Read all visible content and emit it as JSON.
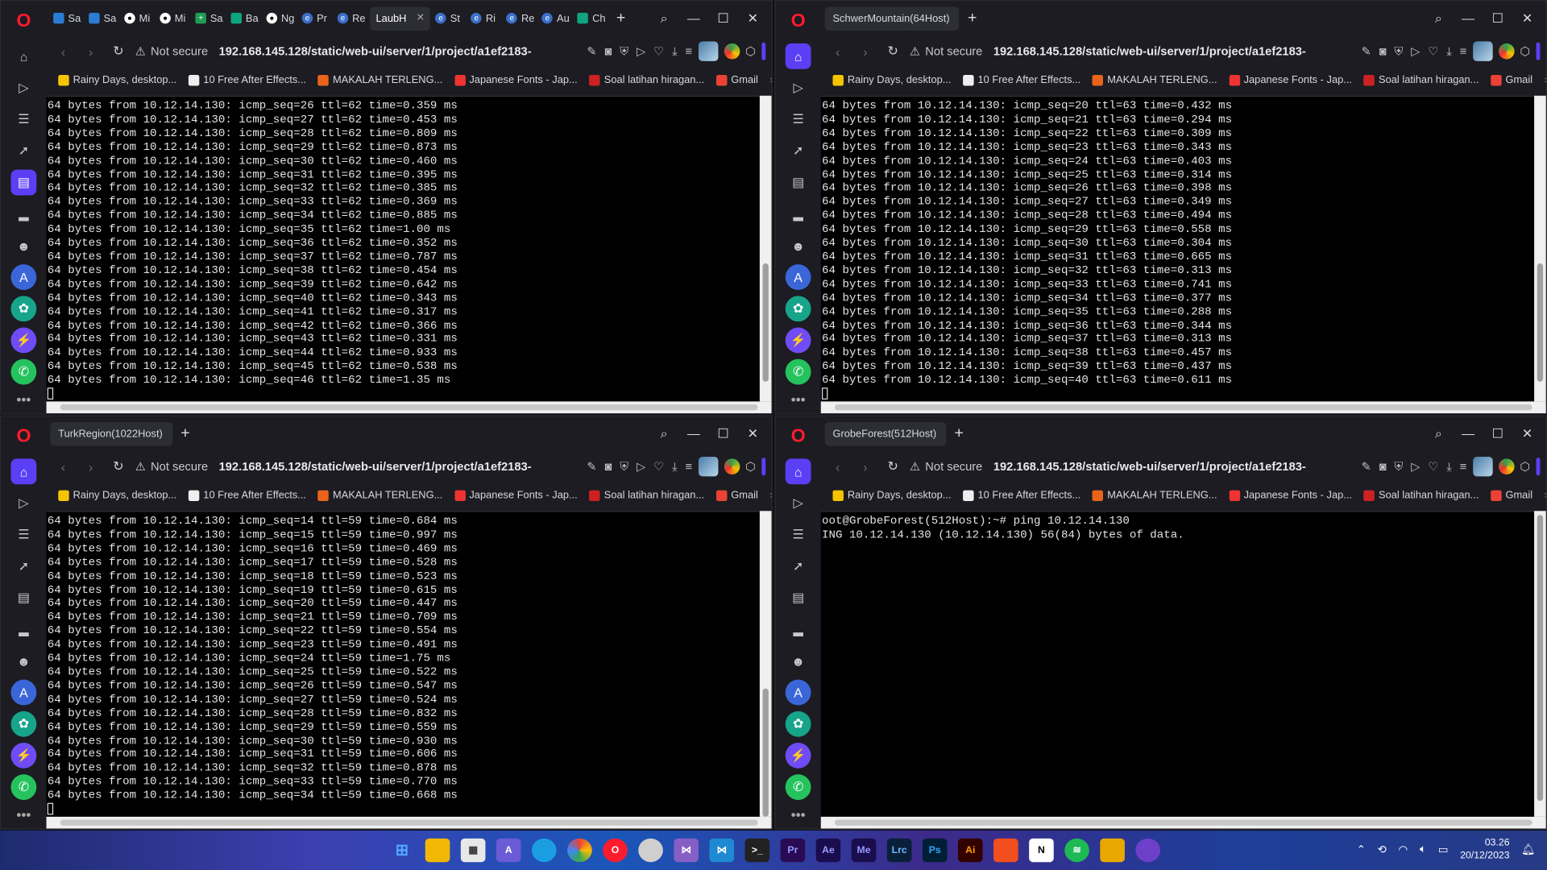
{
  "windows": {
    "tl": {
      "tabs": [
        "Sa",
        "Sa",
        "Mi",
        "Mi",
        "Sa",
        "Ba",
        "Ng",
        "Pr",
        "Re",
        "LaubH",
        "St",
        "Ri",
        "Re",
        "Au",
        "Ch"
      ],
      "active_tab": "LaubH"
    },
    "tr": {
      "tab_title": "SchwerMountain(64Host)"
    },
    "bl": {
      "tab_title": "TurkRegion(1022Host)"
    },
    "br": {
      "tab_title": "GrobeForest(512Host)"
    }
  },
  "browser": {
    "not_secure": "Not secure",
    "url": "192.168.145.128/static/web-ui/server/1/project/a1ef2183-",
    "bookmarks": [
      "Rainy Days, desktop...",
      "10 Free After Effects...",
      "MAKALAH TERLENG...",
      "Japanese Fonts - Jap...",
      "Soal latihan hiragan...",
      "Gmail"
    ],
    "bookmark_more": "»"
  },
  "terminals": {
    "tl": [
      "64 bytes from 10.12.14.130: icmp_seq=26 ttl=62 time=0.359 ms",
      "64 bytes from 10.12.14.130: icmp_seq=27 ttl=62 time=0.453 ms",
      "64 bytes from 10.12.14.130: icmp_seq=28 ttl=62 time=0.809 ms",
      "64 bytes from 10.12.14.130: icmp_seq=29 ttl=62 time=0.873 ms",
      "64 bytes from 10.12.14.130: icmp_seq=30 ttl=62 time=0.460 ms",
      "64 bytes from 10.12.14.130: icmp_seq=31 ttl=62 time=0.395 ms",
      "64 bytes from 10.12.14.130: icmp_seq=32 ttl=62 time=0.385 ms",
      "64 bytes from 10.12.14.130: icmp_seq=33 ttl=62 time=0.369 ms",
      "64 bytes from 10.12.14.130: icmp_seq=34 ttl=62 time=0.885 ms",
      "64 bytes from 10.12.14.130: icmp_seq=35 ttl=62 time=1.00 ms",
      "64 bytes from 10.12.14.130: icmp_seq=36 ttl=62 time=0.352 ms",
      "64 bytes from 10.12.14.130: icmp_seq=37 ttl=62 time=0.787 ms",
      "64 bytes from 10.12.14.130: icmp_seq=38 ttl=62 time=0.454 ms",
      "64 bytes from 10.12.14.130: icmp_seq=39 ttl=62 time=0.642 ms",
      "64 bytes from 10.12.14.130: icmp_seq=40 ttl=62 time=0.343 ms",
      "64 bytes from 10.12.14.130: icmp_seq=41 ttl=62 time=0.317 ms",
      "64 bytes from 10.12.14.130: icmp_seq=42 ttl=62 time=0.366 ms",
      "64 bytes from 10.12.14.130: icmp_seq=43 ttl=62 time=0.331 ms",
      "64 bytes from 10.12.14.130: icmp_seq=44 ttl=62 time=0.933 ms",
      "64 bytes from 10.12.14.130: icmp_seq=45 ttl=62 time=0.538 ms",
      "64 bytes from 10.12.14.130: icmp_seq=46 ttl=62 time=1.35 ms"
    ],
    "tr": [
      "64 bytes from 10.12.14.130: icmp_seq=20 ttl=63 time=0.432 ms",
      "64 bytes from 10.12.14.130: icmp_seq=21 ttl=63 time=0.294 ms",
      "64 bytes from 10.12.14.130: icmp_seq=22 ttl=63 time=0.309 ms",
      "64 bytes from 10.12.14.130: icmp_seq=23 ttl=63 time=0.343 ms",
      "64 bytes from 10.12.14.130: icmp_seq=24 ttl=63 time=0.403 ms",
      "64 bytes from 10.12.14.130: icmp_seq=25 ttl=63 time=0.314 ms",
      "64 bytes from 10.12.14.130: icmp_seq=26 ttl=63 time=0.398 ms",
      "64 bytes from 10.12.14.130: icmp_seq=27 ttl=63 time=0.349 ms",
      "64 bytes from 10.12.14.130: icmp_seq=28 ttl=63 time=0.494 ms",
      "64 bytes from 10.12.14.130: icmp_seq=29 ttl=63 time=0.558 ms",
      "64 bytes from 10.12.14.130: icmp_seq=30 ttl=63 time=0.304 ms",
      "64 bytes from 10.12.14.130: icmp_seq=31 ttl=63 time=0.665 ms",
      "64 bytes from 10.12.14.130: icmp_seq=32 ttl=63 time=0.313 ms",
      "64 bytes from 10.12.14.130: icmp_seq=33 ttl=63 time=0.741 ms",
      "64 bytes from 10.12.14.130: icmp_seq=34 ttl=63 time=0.377 ms",
      "64 bytes from 10.12.14.130: icmp_seq=35 ttl=63 time=0.288 ms",
      "64 bytes from 10.12.14.130: icmp_seq=36 ttl=63 time=0.344 ms",
      "64 bytes from 10.12.14.130: icmp_seq=37 ttl=63 time=0.313 ms",
      "64 bytes from 10.12.14.130: icmp_seq=38 ttl=63 time=0.457 ms",
      "64 bytes from 10.12.14.130: icmp_seq=39 ttl=63 time=0.437 ms",
      "64 bytes from 10.12.14.130: icmp_seq=40 ttl=63 time=0.611 ms"
    ],
    "bl": [
      "64 bytes from 10.12.14.130: icmp_seq=14 ttl=59 time=0.684 ms",
      "64 bytes from 10.12.14.130: icmp_seq=15 ttl=59 time=0.997 ms",
      "64 bytes from 10.12.14.130: icmp_seq=16 ttl=59 time=0.469 ms",
      "64 bytes from 10.12.14.130: icmp_seq=17 ttl=59 time=0.528 ms",
      "64 bytes from 10.12.14.130: icmp_seq=18 ttl=59 time=0.523 ms",
      "64 bytes from 10.12.14.130: icmp_seq=19 ttl=59 time=0.615 ms",
      "64 bytes from 10.12.14.130: icmp_seq=20 ttl=59 time=0.447 ms",
      "64 bytes from 10.12.14.130: icmp_seq=21 ttl=59 time=0.709 ms",
      "64 bytes from 10.12.14.130: icmp_seq=22 ttl=59 time=0.554 ms",
      "64 bytes from 10.12.14.130: icmp_seq=23 ttl=59 time=0.491 ms",
      "64 bytes from 10.12.14.130: icmp_seq=24 ttl=59 time=1.75 ms",
      "64 bytes from 10.12.14.130: icmp_seq=25 ttl=59 time=0.522 ms",
      "64 bytes from 10.12.14.130: icmp_seq=26 ttl=59 time=0.547 ms",
      "64 bytes from 10.12.14.130: icmp_seq=27 ttl=59 time=0.524 ms",
      "64 bytes from 10.12.14.130: icmp_seq=28 ttl=59 time=0.832 ms",
      "64 bytes from 10.12.14.130: icmp_seq=29 ttl=59 time=0.559 ms",
      "64 bytes from 10.12.14.130: icmp_seq=30 ttl=59 time=0.930 ms",
      "64 bytes from 10.12.14.130: icmp_seq=31 ttl=59 time=0.606 ms",
      "64 bytes from 10.12.14.130: icmp_seq=32 ttl=59 time=0.878 ms",
      "64 bytes from 10.12.14.130: icmp_seq=33 ttl=59 time=0.770 ms",
      "64 bytes from 10.12.14.130: icmp_seq=34 ttl=59 time=0.668 ms"
    ],
    "br": [
      "oot@GrobeForest(512Host):~# ping 10.12.14.130",
      "ING 10.12.14.130 (10.12.14.130) 56(84) bytes of data."
    ]
  },
  "taskbar": {
    "apps": [
      "Pr",
      "Ae",
      "Me",
      "Lrc",
      "Ps",
      "Ai"
    ],
    "time": "03.26",
    "date": "20/12/2023"
  },
  "colors": {
    "accent": "#5b3ff5",
    "opera": "#ff1b2d"
  }
}
